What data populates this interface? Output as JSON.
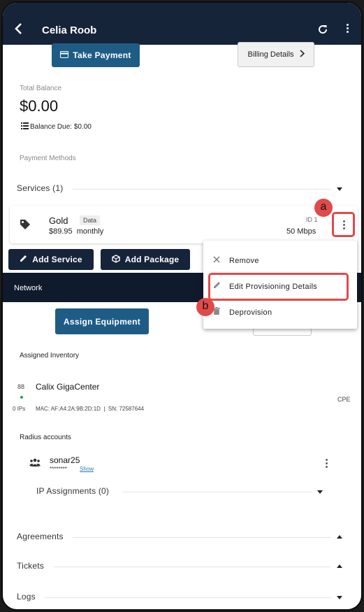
{
  "header": {
    "title": "Celia Roob"
  },
  "actions": {
    "take_payment": "Take Payment",
    "billing_details": "Billing Details"
  },
  "balance": {
    "total_label": "Total Balance",
    "total_value": "$0.00",
    "due_text": "Balance Due: $0.00"
  },
  "payment_methods_label": "Payment Methods",
  "services": {
    "title": "Services (1)",
    "item": {
      "name": "Gold",
      "tag": "Data",
      "price": "$89.95",
      "period": "monthly",
      "id": "ID 1",
      "speed": "50 Mbps"
    },
    "add_service": "Add Service",
    "add_package": "Add Package"
  },
  "network": {
    "title": "Network",
    "assign_equipment": "Assign Equipment"
  },
  "context_menu": {
    "items": [
      {
        "label": "Remove"
      },
      {
        "label": "Edit Provisioning Details"
      },
      {
        "label": "Deprovision"
      }
    ]
  },
  "inventory": {
    "title": "Assigned Inventory",
    "item": {
      "number": "88",
      "ips": "0 IPs",
      "name": "Calix GigaCenter",
      "details": "MAC: AF:A4:2A:9B:2D:1D  |  SN: 72587644",
      "type": "CPE"
    }
  },
  "radius": {
    "title": "Radius accounts",
    "account": {
      "username": "sonar25",
      "password": "********",
      "show": "Show"
    },
    "ip_assignments": "IP Assignments (0)"
  },
  "sections": {
    "agreements": "Agreements",
    "tickets": "Tickets",
    "logs": "Logs"
  },
  "annotations": {
    "a": "a",
    "b": "b"
  },
  "colors": {
    "header": "#16243a",
    "accent_blue": "#1e5c86",
    "highlight": "#e04a4a",
    "status_green": "#2e9e4f"
  }
}
